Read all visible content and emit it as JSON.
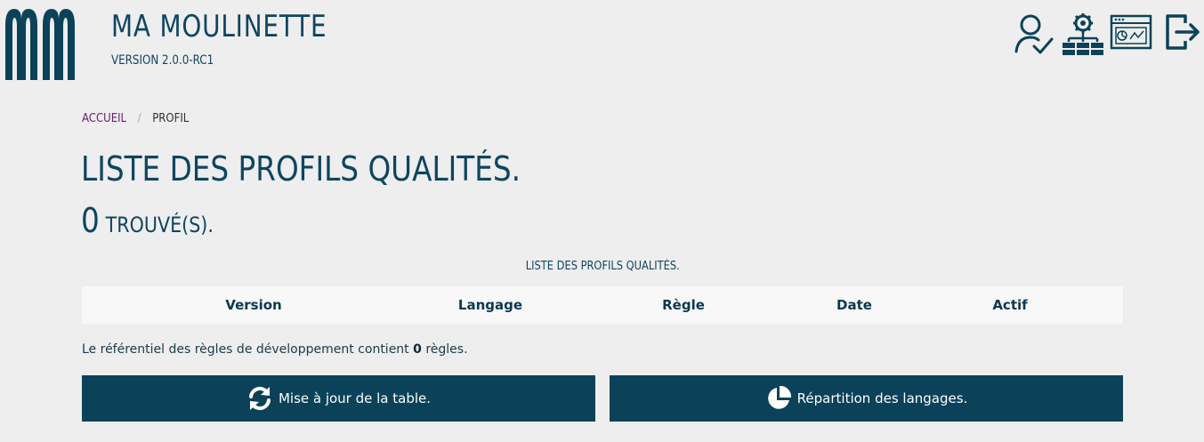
{
  "header": {
    "title": "MA MOULINETTE",
    "version": "VERSION 2.0.0-RC1",
    "logo_letters": "MM",
    "icons": [
      "user-check-icon",
      "settings-network-icon",
      "dashboard-window-icon",
      "logout-icon"
    ]
  },
  "breadcrumb": {
    "home": "ACCUEIL",
    "separator": "/",
    "current": "PROFIL"
  },
  "page": {
    "title": "LISTE DES PROFILS QUALITÉS.",
    "found_count": "0",
    "found_label": "TROUVÉ(S)."
  },
  "table": {
    "caption": "LISTE DES PROFILS QUALITÉS.",
    "columns": [
      "Version",
      "Langage",
      "Règle",
      "Date",
      "Actif"
    ],
    "rows": []
  },
  "info": {
    "prefix": "Le référentiel des règles de développement contient",
    "count": "0",
    "suffix": "règles."
  },
  "actions": {
    "refresh_label": "Mise à jour de la table.",
    "repartition_label": "Répartition des langages."
  },
  "colors": {
    "background": "#eeeeee",
    "primary": "#0b4259",
    "link": "#6b1d6e",
    "table_header_bg": "#f8f8f8"
  }
}
